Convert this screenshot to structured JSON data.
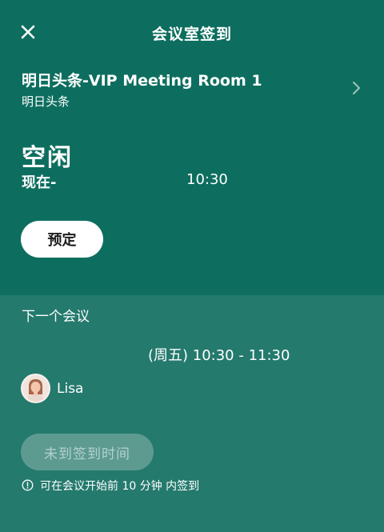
{
  "header": {
    "title": "会议室签到"
  },
  "room": {
    "name": "明日头条-VIP Meeting Room 1",
    "building": "明日头条"
  },
  "status": {
    "label": "空闲",
    "now_label": "现在-",
    "now_time": "10:30",
    "reserve_label": "预定"
  },
  "next_meeting": {
    "label": "下一个会议",
    "time": "(周五) 10:30 - 11:30",
    "host": "Lisa"
  },
  "checkin": {
    "button_label": "未到签到时间",
    "hint": "可在会议开始前 10 分钟 内签到"
  },
  "colors": {
    "top_bg": "#0d6e5f",
    "bottom_bg": "#247a6d",
    "disabled_button": "#5d9b91"
  },
  "icons": {
    "close": "close-icon",
    "chevron": "chevron-right-icon",
    "info": "info-icon"
  }
}
